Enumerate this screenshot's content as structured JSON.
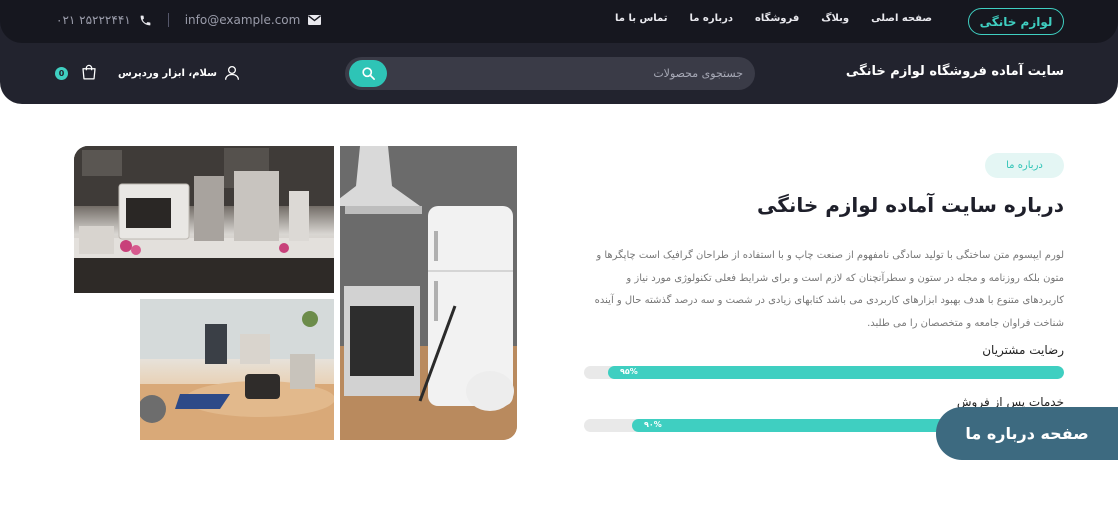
{
  "topbar": {
    "brand_button": "لوازم خانگی",
    "nav": [
      "صفحه اصلی",
      "وبلاگ",
      "فروشگاه",
      "درباره ما",
      "تماس با ما"
    ],
    "email": "info@example.com",
    "phone": "۰۲۱ ۲۵۲۲۲۴۴۱"
  },
  "header": {
    "site_title": "سایت آماده فروشگاه لوازم خانگی",
    "search_placeholder": "جستجوی محصولات",
    "user_greeting": "سلام، ابزار وردپرس",
    "cart_count": "0"
  },
  "about": {
    "badge": "درباره ما",
    "title": "درباره سایت آماده لوازم خانگی",
    "text": "لورم ایپسوم متن ساختگی با تولید سادگی نامفهوم از صنعت چاپ و با استفاده از طراحان گرافیک است چاپگرها و متون بلکه روزنامه و مجله در ستون و سطرآنچنان که لازم است و برای شرایط فعلی تکنولوژی مورد نیاز و کاربردهای متنوع با هدف بهبود ابزارهای کاربردی می باشد کتابهای زیادی در شصت و سه درصد گذشته حال و آینده شناخت فراوان جامعه و متخصصان را می طلبد.",
    "stats": [
      {
        "label": "رضایت مشتریان",
        "value_text": "۹۵%",
        "percent": 95
      },
      {
        "label": "خدمات پس از فروش",
        "value_text": "۹۰%",
        "percent": 90
      }
    ]
  },
  "page_label": "صفحه درباره ما",
  "colors": {
    "accent": "#3fcfc1",
    "header_bg": "#22232e",
    "topbar_bg": "#16171f",
    "pill_bg": "#3d6a80"
  }
}
